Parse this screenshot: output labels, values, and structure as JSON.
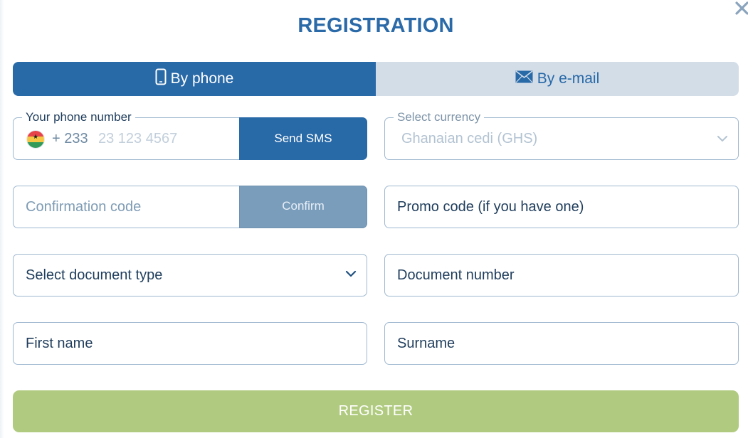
{
  "title": "REGISTRATION",
  "close_icon": "close-icon",
  "tabs": [
    {
      "label": "By phone",
      "icon": "phone-icon",
      "active": true
    },
    {
      "label": "By e-mail",
      "icon": "mail-icon",
      "active": false
    }
  ],
  "phone": {
    "legend": "Your phone number",
    "country_flag": "ghana-flag-icon",
    "dial_code": "+ 233",
    "placeholder": "23 123 4567",
    "send_sms_label": "Send SMS"
  },
  "currency": {
    "legend": "Select currency",
    "value": "Ghanaian cedi (GHS)"
  },
  "confirmation": {
    "placeholder": "Confirmation code",
    "confirm_label": "Confirm"
  },
  "promo": {
    "placeholder": "Promo code (if you have one)"
  },
  "document_type": {
    "placeholder": "Select document type"
  },
  "document_number": {
    "placeholder": "Document number"
  },
  "first_name": {
    "placeholder": "First name"
  },
  "surname": {
    "placeholder": "Surname"
  },
  "register_label": "REGISTER",
  "colors": {
    "primary": "#2869a7",
    "tab_inactive": "#d3dde8",
    "register_disabled": "#b0cb80",
    "border": "#9fb8d0"
  }
}
